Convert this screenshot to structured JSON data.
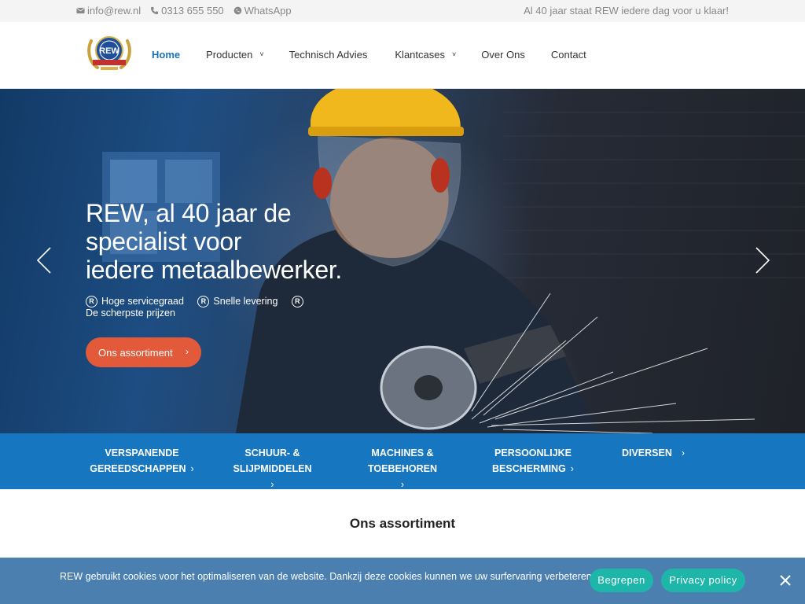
{
  "topbar": {
    "email": "info@rew.nl",
    "phone": "0313 655 550",
    "whatsapp": "WhatsApp",
    "tagline": "Al 40 jaar staat REW iedere dag voor u klaar!"
  },
  "logo": {
    "text": "REW",
    "icon": "rew-logo-icon"
  },
  "nav": [
    {
      "label": "Home",
      "active": true,
      "dropdown": false
    },
    {
      "label": "Producten",
      "active": false,
      "dropdown": true
    },
    {
      "label": "Technisch Advies",
      "active": false,
      "dropdown": false
    },
    {
      "label": "Klantcases",
      "active": false,
      "dropdown": true
    },
    {
      "label": "Over Ons",
      "active": false,
      "dropdown": false
    },
    {
      "label": "Contact",
      "active": false,
      "dropdown": false
    }
  ],
  "hero": {
    "title_line1": "REW, al 40 jaar de",
    "title_line2": "specialist voor",
    "title_line3": "iedere metaalbewerker.",
    "features": [
      "Hoge servicegraad",
      "Snelle levering",
      "De scherpste prijzen"
    ],
    "badge_glyph": "R",
    "cta_label": "Ons assortiment",
    "chevron": "›"
  },
  "categories": [
    {
      "line1": "Verspanende",
      "line2": "Gereedschappen"
    },
    {
      "line1": "Schuur- & slijpmiddelen",
      "line2": ""
    },
    {
      "line1": "Machines & toebehoren",
      "line2": ""
    },
    {
      "line1": "Persoonlijke",
      "line2": "bescherming"
    },
    {
      "line1": "Diversen",
      "line2": ""
    }
  ],
  "section": {
    "title": "Ons assortiment"
  },
  "cookie": {
    "message": "REW gebruikt cookies voor het optimaliseren van de website. Dankzij deze cookies kunnen we uw surfervaring verbeteren.",
    "accept_label": "Begrepen",
    "privacy_label": "Privacy policy"
  },
  "colors": {
    "accent_blue": "#1a73b8",
    "category_bar": "#1676c0",
    "cta_orange": "#e35a3b",
    "cookie_bar": "#4a7fb0",
    "cookie_button": "#1fb6aa"
  }
}
